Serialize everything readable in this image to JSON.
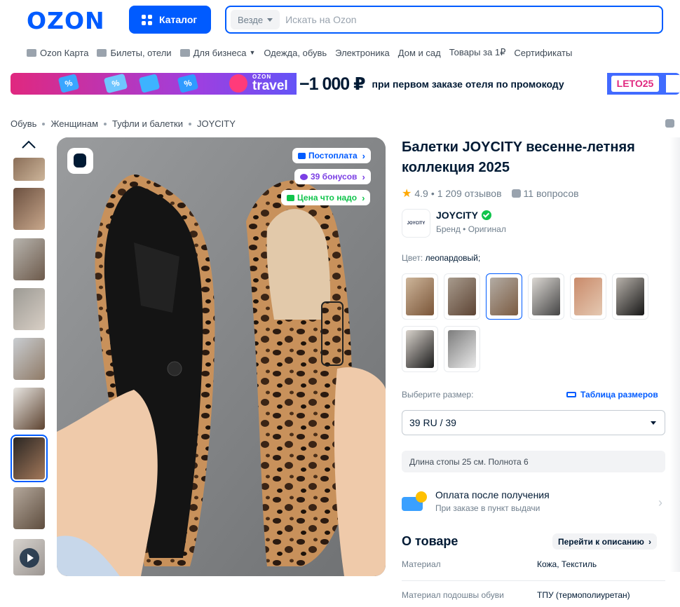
{
  "header": {
    "logo": "OZON",
    "catalog_label": "Каталог",
    "search_scope": "Везде",
    "search_placeholder": "Искать на Ozon"
  },
  "nav": {
    "items": [
      "Ozon Карта",
      "Билеты, отели",
      "Для бизнеса",
      "Одежда, обувь",
      "Электроника",
      "Дом и сад",
      "Товары за 1₽",
      "Сертификаты"
    ]
  },
  "banner": {
    "brand_small": "OZON",
    "brand": "travel",
    "amount": "−1 000 ₽",
    "text": "при первом заказе отеля по промокоду",
    "promo_code": "LETO25"
  },
  "breadcrumb": [
    "Обувь",
    "Женщинам",
    "Туфли и балетки",
    "JOYCITY"
  ],
  "badges": {
    "postpay": "Постоплата",
    "bonuses": "39 бонусов",
    "good_price": "Цена что надо"
  },
  "product": {
    "title": "Балетки JOYCITY весенне-летняя коллекция 2025",
    "rating": "4.9",
    "reviews": "1 209 отзывов",
    "questions": "11 вопросов",
    "brand_logo_text": "JOYCITY",
    "brand": "JOYCITY",
    "brand_sub": "Бренд • Оригинал",
    "color_label": "Цвет:",
    "color_value": "леопардовый;"
  },
  "size": {
    "label": "Выберите размер:",
    "table_link": "Таблица размеров",
    "selected": "39 RU / 39",
    "foot_note": "Длина стопы 25 см. Полнота 6"
  },
  "payment": {
    "title": "Оплата после получения",
    "subtitle": "При заказе в пункт выдачи"
  },
  "about": {
    "title": "О товаре",
    "go_to_description": "Перейти к описанию",
    "props": [
      {
        "key": "Материал",
        "value": "Кожа, Текстиль"
      },
      {
        "key": "Материал подошвы обуви",
        "value": "ТПУ (термополиуретан)"
      }
    ]
  },
  "colors": {
    "brand_blue": "#005bff",
    "text_dark": "#001a34",
    "muted": "#707f8d",
    "green": "#10c44c",
    "star": "#ffa800"
  }
}
